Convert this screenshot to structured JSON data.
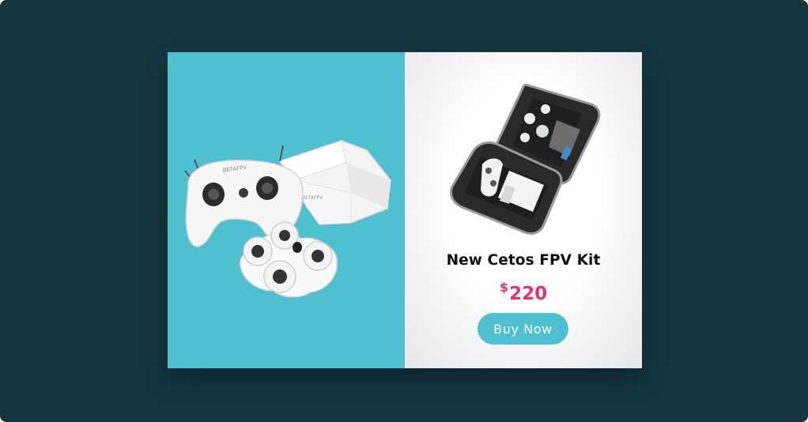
{
  "product": {
    "title": "New Cetos FPV Kit",
    "currency": "$",
    "price": "220",
    "buy_label": "Buy Now"
  },
  "images": {
    "left": "fpv-kit-bundle-illustration",
    "right": "fpv-kit-carry-case-illustration"
  },
  "colors": {
    "background": "#13363f",
    "accent": "#4fc0d0",
    "price": "#e8336a",
    "title": "#111111"
  }
}
